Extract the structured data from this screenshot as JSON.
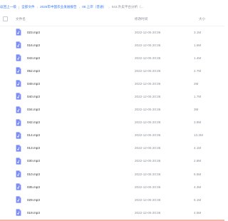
{
  "breadcrumb": {
    "items": [
      "返回上一级",
      "全部文件",
      "2025年中国农业发展报告",
      "08.上岸（普通）",
      "043.外卖平台分析"
    ],
    "current": "043.外卖平台分析（..."
  },
  "table": {
    "headers": {
      "name": "文件名",
      "date": "修改时间",
      "size": "大小"
    },
    "rows": [
      {
        "name": "023.mp3",
        "date": "2022-12-05 20:36",
        "size": "3.1M"
      },
      {
        "name": "016.mp3",
        "date": "2022-12-05 20:36",
        "size": "1.6M"
      },
      {
        "name": "043.mp3",
        "date": "2022-12-05 20:36",
        "size": "1.4M"
      },
      {
        "name": "052.mp3",
        "date": "2022-12-05 20:36",
        "size": "2.7M"
      },
      {
        "name": "049.mp3",
        "date": "2022-12-05 20:36",
        "size": "2M"
      },
      {
        "name": "040.mp3",
        "date": "2022-12-05 20:36",
        "size": "1.7M"
      },
      {
        "name": "034.mp3",
        "date": "2022-12-05 20:36",
        "size": "3M"
      },
      {
        "name": "042.mp3",
        "date": "2022-12-05 20:36",
        "size": "3.8M"
      },
      {
        "name": "014.mp3",
        "date": "2022-12-05 20:36",
        "size": "13.3M"
      },
      {
        "name": "013.mp3",
        "date": "2022-12-05 20:36",
        "size": "4.1M"
      },
      {
        "name": "030.mp3",
        "date": "2022-12-05 20:36",
        "size": "2.8M"
      },
      {
        "name": "010.mp3",
        "date": "2022-12-05 20:36",
        "size": "6.5M"
      },
      {
        "name": "035.mp3",
        "date": "2022-12-05 20:36",
        "size": "4.3M"
      },
      {
        "name": "029.mp3",
        "date": "2022-12-05 20:36",
        "size": "5.1M"
      },
      {
        "name": "019.mp3",
        "date": "2022-12-05 20:36",
        "size": "4.5M"
      }
    ]
  },
  "icons": {
    "file": "audio-file-icon"
  },
  "colors": {
    "link": "#3a7bf5",
    "icon": "#7b8cf7",
    "muted": "#8a8f99"
  }
}
